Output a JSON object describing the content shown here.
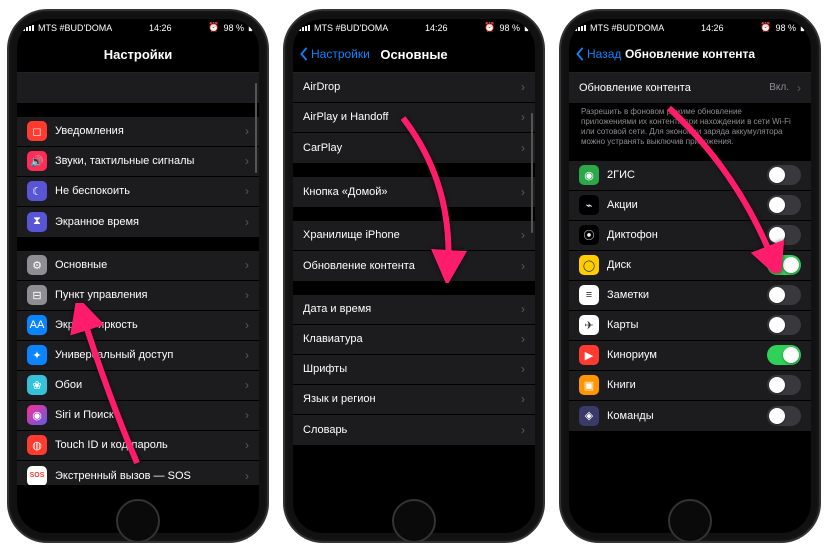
{
  "status": {
    "carrier": "MTS #BUD'DOMA",
    "time": "14:26",
    "battery": "98 %",
    "alarm_icon": "⏰"
  },
  "phone1": {
    "title": "Настройки",
    "rows": {
      "notifications": "Уведомления",
      "sounds": "Звуки, тактильные сигналы",
      "dnd": "Не беспокоить",
      "screentime": "Экранное время",
      "general": "Основные",
      "controlcenter": "Пункт управления",
      "display": "Экран и яркость",
      "accessibility": "Универсальный доступ",
      "wallpaper": "Обои",
      "siri": "Siri и Поиск",
      "touchid": "Touch ID и код-пароль",
      "sos": "Экстренный вызов — SOS"
    }
  },
  "phone2": {
    "back": "Настройки",
    "title": "Основные",
    "rows": {
      "airdrop": "AirDrop",
      "airplay": "AirPlay и Handoff",
      "carplay": "CarPlay",
      "homebtn": "Кнопка «Домой»",
      "storage": "Хранилище iPhone",
      "refresh": "Обновление контента",
      "datetime": "Дата и время",
      "keyboard": "Клавиатура",
      "fonts": "Шрифты",
      "language": "Язык и регион",
      "dictionary": "Словарь"
    }
  },
  "phone3": {
    "back": "Назад",
    "title": "Обновление контента",
    "header_row": {
      "label": "Обновление контента",
      "value": "Вкл."
    },
    "footer": "Разрешить в фоновом режиме обновление приложениями их контента при нахождении в сети Wi-Fi или сотовой сети. Для экономии заряда аккумулятора можно устранять выключив приложения.",
    "apps": [
      {
        "name": "2ГИС",
        "on": false,
        "color": "#2aa84a",
        "glyph": "◉"
      },
      {
        "name": "Акции",
        "on": false,
        "color": "#000",
        "glyph": "⌁"
      },
      {
        "name": "Диктофон",
        "on": false,
        "color": "#000",
        "glyph": "⦿"
      },
      {
        "name": "Диск",
        "on": true,
        "color": "#ffcc00",
        "glyph": "◯"
      },
      {
        "name": "Заметки",
        "on": false,
        "color": "#fff",
        "glyph": "≡"
      },
      {
        "name": "Карты",
        "on": false,
        "color": "#fff",
        "glyph": "✈"
      },
      {
        "name": "Кинориум",
        "on": true,
        "color": "#ff3b30",
        "glyph": "▶"
      },
      {
        "name": "Книги",
        "on": false,
        "color": "#ff9500",
        "glyph": "▣"
      },
      {
        "name": "Команды",
        "on": false,
        "color": "#3a3a6a",
        "glyph": "◈"
      }
    ]
  },
  "colors": {
    "notifications": "#ff3b30",
    "sounds": "#ff3b30",
    "dnd": "#5856d6",
    "screentime": "#5856d6",
    "general": "#8e8e93",
    "controlcenter": "#8e8e93",
    "display": "#0a84ff",
    "accessibility": "#0a84ff",
    "wallpaper": "#34c2db",
    "siri": "#000",
    "touchid": "#ff3b30",
    "sos": "#fff"
  },
  "arrow_color": "#ff1d6b"
}
